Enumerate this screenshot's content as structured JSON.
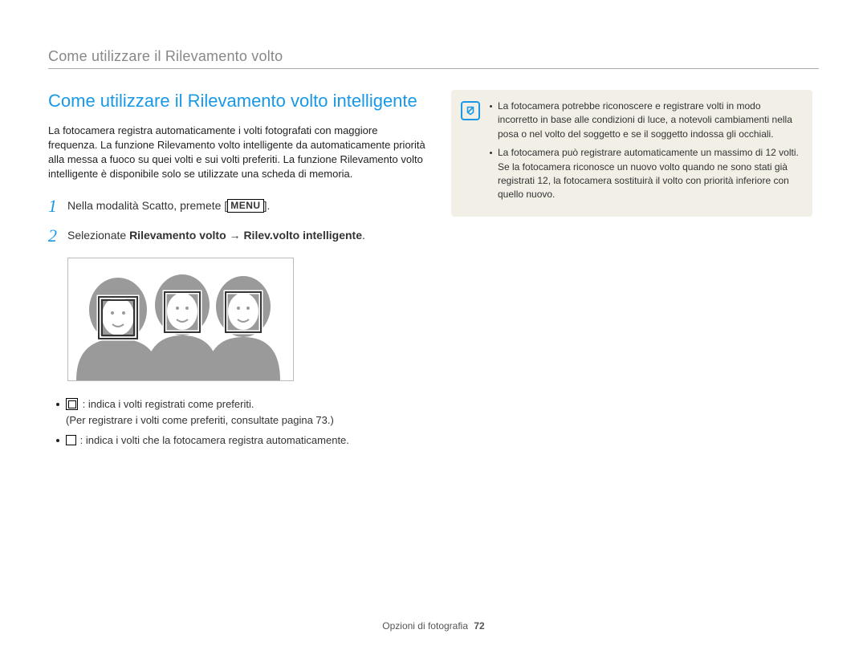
{
  "header": {
    "running_title": "Come utilizzare il Rilevamento volto"
  },
  "main": {
    "section_title": "Come utilizzare il Rilevamento volto intelligente",
    "intro": "La fotocamera registra automaticamente i volti fotografati con maggiore frequenza. La funzione Rilevamento volto intelligente da automaticamente priorità alla messa a fuoco su quei volti e sui volti preferiti. La funzione Rilevamento volto intelligente è disponibile solo se utilizzate una scheda di memoria.",
    "steps": [
      {
        "num": "1",
        "pre": "Nella modalità Scatto, premete [",
        "menu_label": "MENU",
        "post": "]."
      },
      {
        "num": "2",
        "prefix": "Selezionate ",
        "bold1": "Rilevamento volto",
        "arrow": " → ",
        "bold2": "Rilev.volto intelligente",
        "suffix": "."
      }
    ],
    "legend": {
      "item1_text": ": indica i volti registrati come preferiti.",
      "item1_note": "(Per registrare i volti come preferiti, consultate pagina 73.)",
      "item2_text": ": indica i volti che la fotocamera registra automaticamente."
    }
  },
  "note": {
    "items": [
      "La fotocamera potrebbe riconoscere e registrare volti in modo incorretto in base alle condizioni di luce, a notevoli cambiamenti nella posa o nel volto del soggetto e se il soggetto indossa gli occhiali.",
      "La fotocamera può registrare automaticamente un massimo di 12 volti. Se la fotocamera riconosce un nuovo volto quando ne sono stati già registrati 12, la fotocamera sostituirà il volto con priorità inferiore con quello nuovo."
    ]
  },
  "footer": {
    "section": "Opzioni di fotografia",
    "page": "72"
  }
}
